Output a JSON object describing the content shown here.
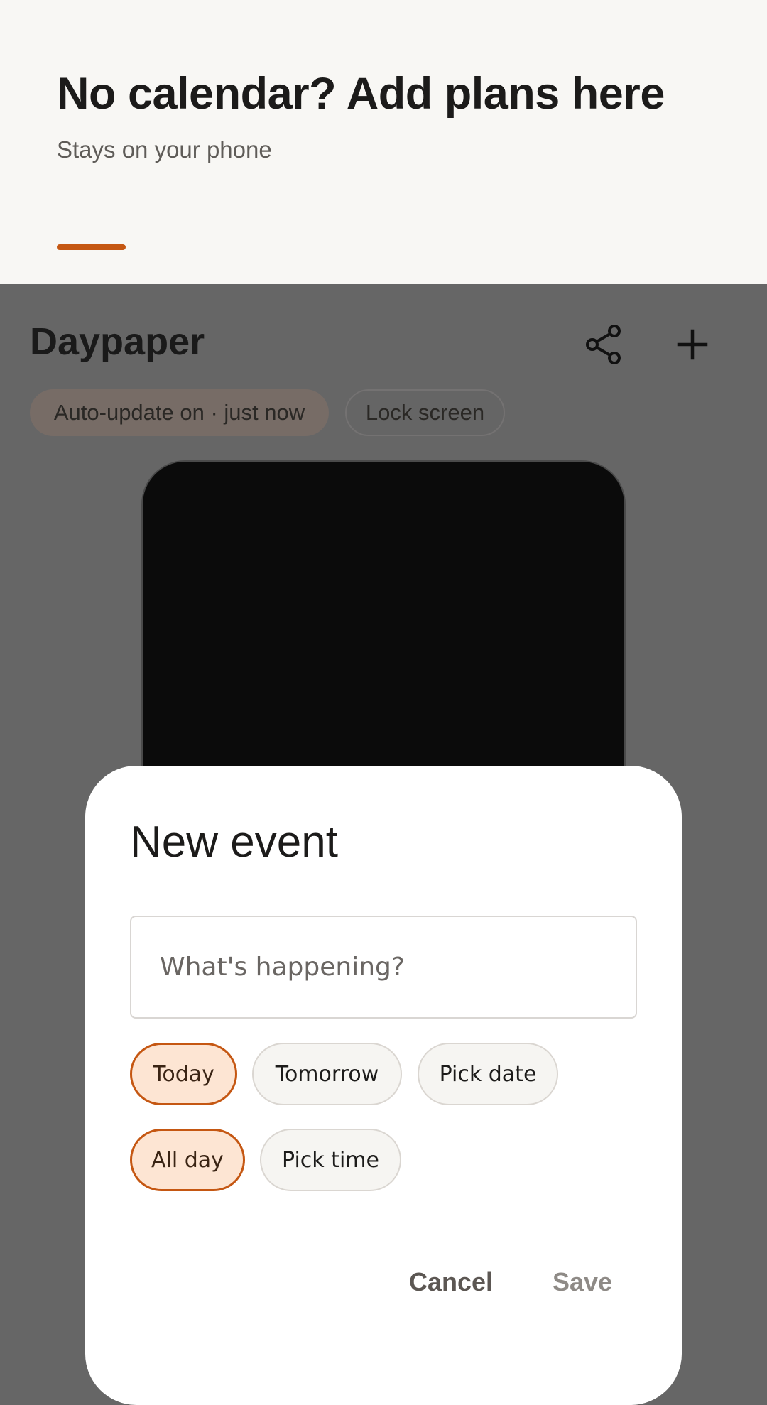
{
  "banner": {
    "title": "No calendar? Add plans here",
    "subtitle": "Stays on your phone",
    "accent_color": "#c55712"
  },
  "app": {
    "title": "Daypaper",
    "share_icon": "share-icon",
    "add_icon": "plus-icon",
    "chips": {
      "auto_update": "Auto-update on · just now",
      "lock_screen": "Lock screen"
    }
  },
  "dialog": {
    "title": "New event",
    "input": {
      "placeholder": "What's happening?",
      "value": ""
    },
    "date_options": [
      {
        "label": "Today",
        "selected": true
      },
      {
        "label": "Tomorrow",
        "selected": false
      },
      {
        "label": "Pick date",
        "selected": false
      }
    ],
    "time_options": [
      {
        "label": "All day",
        "selected": true
      },
      {
        "label": "Pick time",
        "selected": false
      }
    ],
    "cancel_label": "Cancel",
    "save_label": "Save"
  }
}
